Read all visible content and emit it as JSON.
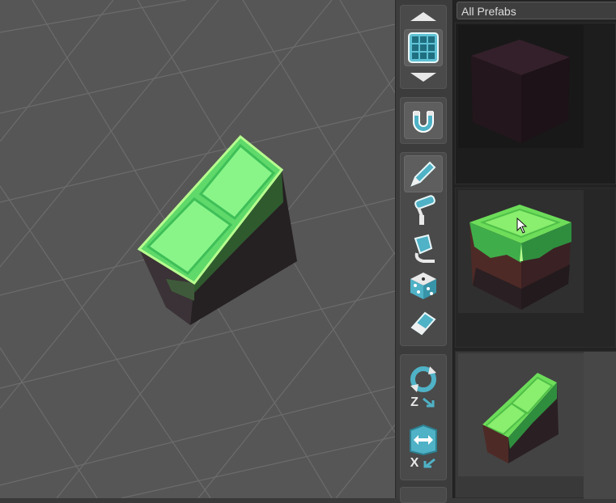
{
  "palette": {
    "filter_label": "All Prefabs",
    "prefabs": [
      {
        "name": "dark-cube-icon",
        "color": "#2c1a1f"
      },
      {
        "name": "grass-block-icon",
        "color": "#6ddd5a"
      },
      {
        "name": "grass-slope-icon",
        "color": "#6ddd5a"
      }
    ]
  },
  "toolbar": {
    "accent_color": "#4fb2c6",
    "rotate_axis_label": "Z",
    "flip_axis_label": "X",
    "tools": [
      {
        "icon": "grid-icon",
        "active": true
      },
      {
        "icon": "magnet-icon",
        "active": true
      },
      {
        "icon": "pencil-icon",
        "active": true
      },
      {
        "icon": "paint-roller-icon",
        "active": false
      },
      {
        "icon": "paint-bucket-icon",
        "active": false
      },
      {
        "icon": "dice-icon",
        "active": false
      },
      {
        "icon": "eraser-icon",
        "active": false
      },
      {
        "icon": "rotate-icon",
        "active": false
      },
      {
        "icon": "flip-icon",
        "active": false
      }
    ]
  },
  "scene": {
    "object": "grass-slope-block",
    "highlight_color": "#7cf07c"
  }
}
